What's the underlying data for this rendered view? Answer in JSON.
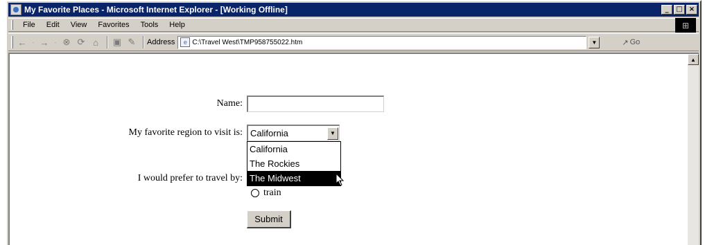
{
  "window": {
    "title": "My Favorite Places - Microsoft Internet Explorer - [Working Offline]",
    "buttons": [
      "_",
      "□",
      "×"
    ]
  },
  "menu": [
    "File",
    "Edit",
    "View",
    "Favorites",
    "Tools",
    "Help"
  ],
  "toolbar": {
    "address_label": "Address",
    "address_value": "C:\\Travel West\\TMP958755022.htm",
    "go_label": "Go"
  },
  "form": {
    "name_label": "Name:",
    "name_value": "",
    "region_label": "My favorite region to visit is:",
    "region_selected": "California",
    "region_options": [
      "California",
      "The Rockies",
      "The Midwest"
    ],
    "region_highlighted": "The Midwest",
    "travel_label": "I would prefer to travel by:",
    "travel_option": "train",
    "submit_label": "Submit"
  },
  "icons": {
    "back": "back-arrow-icon",
    "forward": "forward-arrow-icon",
    "stop": "stop-icon",
    "refresh": "refresh-icon",
    "home": "home-icon",
    "print": "print-icon",
    "edit": "edit-icon"
  }
}
